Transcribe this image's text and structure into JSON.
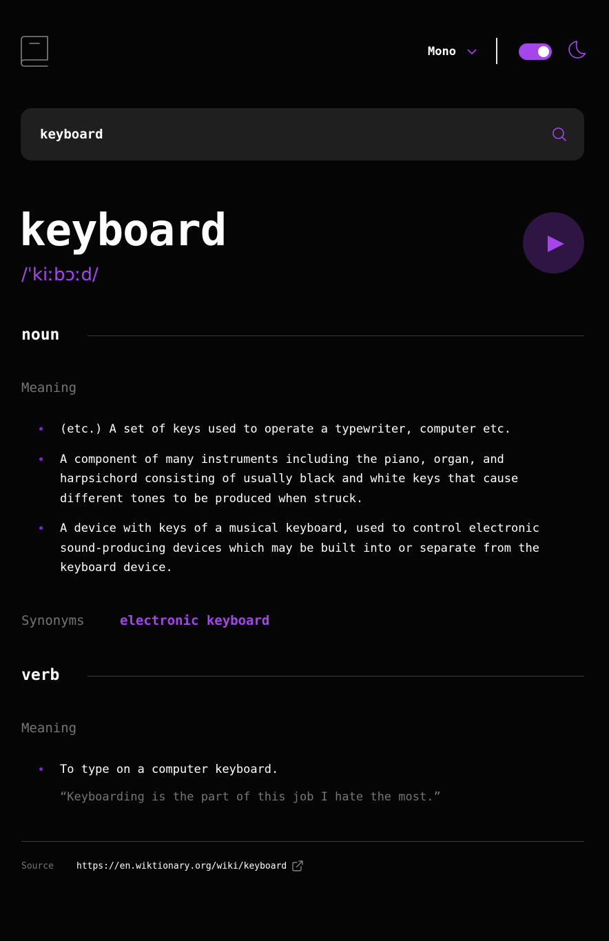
{
  "header": {
    "font_selector": {
      "selected": "Mono"
    },
    "theme": {
      "dark_mode": true,
      "accent": "#a445ed"
    }
  },
  "search": {
    "value": "keyboard",
    "placeholder": ""
  },
  "entry": {
    "word": "keyboard",
    "phonetic": "/ˈkiːbɔːd/",
    "noun": {
      "label": "noun",
      "meaning_label": "Meaning",
      "definitions": [
        "(etc.) A set of keys used to operate a typewriter, computer etc.",
        "A component of many instruments including the piano, organ, and harpsichord consisting of usually black and white keys that cause different tones to be produced when struck.",
        "A device with keys of a musical keyboard, used to control electronic sound-producing devices which may be built into or separate from the keyboard device."
      ],
      "synonyms_label": "Synonyms",
      "synonyms": [
        "electronic keyboard"
      ]
    },
    "verb": {
      "label": "verb",
      "meaning_label": "Meaning",
      "definitions": [
        "To type on a computer keyboard."
      ],
      "example": "“Keyboarding is the part of this job I hate the most.”"
    }
  },
  "footer": {
    "source_label": "Source",
    "source_url": "https://en.wiktionary.org/wiki/keyboard"
  },
  "colors": {
    "background": "#050505",
    "accent": "#a445ed",
    "muted": "#757575",
    "search_bg": "#1f1f1f",
    "play_bg": "#2e1543"
  }
}
